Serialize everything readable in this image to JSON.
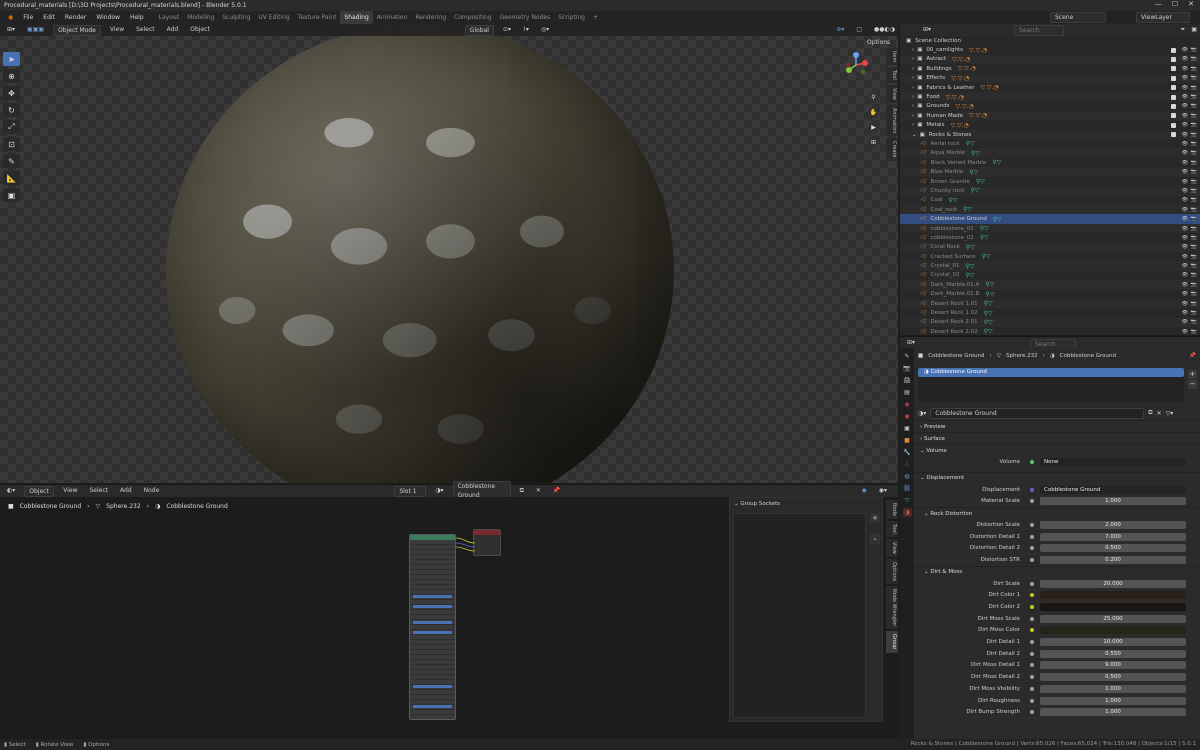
{
  "titlebar": {
    "title": "Procedural_materials [D:\\3D Projects\\Procedural_materials.blend] - Blender 5.0.1"
  },
  "menubar": {
    "menus": [
      "File",
      "Edit",
      "Render",
      "Window",
      "Help"
    ],
    "workspaces": [
      "Layout",
      "Modeling",
      "Sculpting",
      "UV Editing",
      "Texture Paint",
      "Shading",
      "Animation",
      "Rendering",
      "Compositing",
      "Geometry Nodes",
      "Scripting"
    ],
    "active_workspace": "Shading",
    "scene": "Scene",
    "view_layer": "ViewLayer"
  },
  "viewport": {
    "mode": "Object Mode",
    "menus": [
      "View",
      "Select",
      "Add",
      "Object"
    ],
    "orientation": "Global",
    "options": "Options",
    "ntabs": [
      "Item",
      "Tool",
      "View",
      "Animation",
      "Create"
    ]
  },
  "node_editor": {
    "type": "Object",
    "menus": [
      "View",
      "Select",
      "Add",
      "Node"
    ],
    "slot": "Slot 1",
    "material": "Cobblestone Ground",
    "crumbs": [
      "Cobblestone Ground",
      "Sphere.232",
      "Cobblestone Ground"
    ],
    "group_sockets": "Group Sockets",
    "ntabs": [
      "Node",
      "Tool",
      "View",
      "Options",
      "Node Wrangler",
      "Group"
    ]
  },
  "outliner": {
    "search_placeholder": "Search",
    "root": "Scene Collection",
    "collections": [
      "00_camlights",
      "Astract",
      "Buildings",
      "Effects",
      "Fabrics & Leather",
      "Food",
      "Grounds",
      "Human Made",
      "Metals",
      "Rocks & Stones"
    ],
    "items": [
      "Aerial rock",
      "Aqua Marble",
      "Black Veined Marble",
      "Blue Marble",
      "Brown Granite",
      "Chunky rock",
      "Coal",
      "Coal_rock",
      "Cobblestone Ground",
      "cobblestone_01",
      "cobblestone_02",
      "Coral Rock",
      "Cracked Surface",
      "Crystal_01",
      "Crystal_02",
      "Dark_Marble.01.A",
      "Dark_Marble.01.B",
      "Desert Rock 1.01",
      "Desert Rock 1.02",
      "Desert Rock 2.01",
      "Desert Rock 2.02"
    ],
    "selected": "Cobblestone Ground"
  },
  "properties": {
    "search_placeholder": "Search",
    "crumbs": [
      "Cobblestone Ground",
      "Sphere.232",
      "Cobblestone Ground"
    ],
    "slot_item": "Cobblestone Ground",
    "material_name": "Cobblestone Ground",
    "sections": {
      "preview": "Preview",
      "surface": "Surface",
      "volume": "Volume",
      "displacement": "Displacement",
      "rock": "Rock Distortion",
      "dirt": "Dirt & Moss"
    },
    "volume_row": {
      "label": "Volume",
      "value": "None"
    },
    "disp_rows": [
      {
        "label": "Displacement",
        "value": "Cobblestone Ground"
      },
      {
        "label": "Material Scale",
        "value": "1.000"
      }
    ],
    "rock_rows": [
      {
        "label": "Distortion Scale",
        "value": "2.000",
        "fill": 0
      },
      {
        "label": "Distortion Detail 1",
        "value": "7.000",
        "fill": 0
      },
      {
        "label": "Distortion Detail 2",
        "value": "0.500",
        "fill": 0.5
      },
      {
        "label": "Distortion STR",
        "value": "0.200",
        "fill": 0.2
      }
    ],
    "dirt_rows": [
      {
        "label": "Dirt Scale",
        "value": "20.000",
        "fill": 0
      },
      {
        "label": "Dirt Color 1",
        "value": "",
        "color": "#2a2017"
      },
      {
        "label": "Dirt Color 2",
        "value": "",
        "color": "#1a1510"
      },
      {
        "label": "Dirt Moss Scale",
        "value": "25.000",
        "fill": 0
      },
      {
        "label": "Dirt Moss Color",
        "value": "",
        "color": "#23251a"
      },
      {
        "label": "Dirt Detail 1",
        "value": "10.000",
        "fill": 0
      },
      {
        "label": "Dirt Detail 2",
        "value": "0.550",
        "fill": 0.55
      },
      {
        "label": "Dirt Moss Detail 1",
        "value": "9.000",
        "fill": 0
      },
      {
        "label": "Dirt Moss Detail 2",
        "value": "0.500",
        "fill": 0.5
      },
      {
        "label": "Dirt Moss Visibility",
        "value": "1.000",
        "fill": 0
      },
      {
        "label": "Dirt Roughness",
        "value": "1.000",
        "fill": 0
      },
      {
        "label": "Dirt Bump Strength",
        "value": "1.000",
        "fill": 1
      }
    ]
  },
  "status": {
    "left": [
      "Select",
      "Rotate View",
      "Options"
    ],
    "right": "Rocks & Stones | Cobblestone Ground | Verts:65,026 | Faces:65,024 | Tris:130,048 | Objects:1/15 | 5.0.1"
  },
  "colors": {
    "accent": "#4772b3",
    "selection": "#334d80",
    "object_icon": "#e0873a",
    "mesh_icon": "#4ab3a0"
  }
}
